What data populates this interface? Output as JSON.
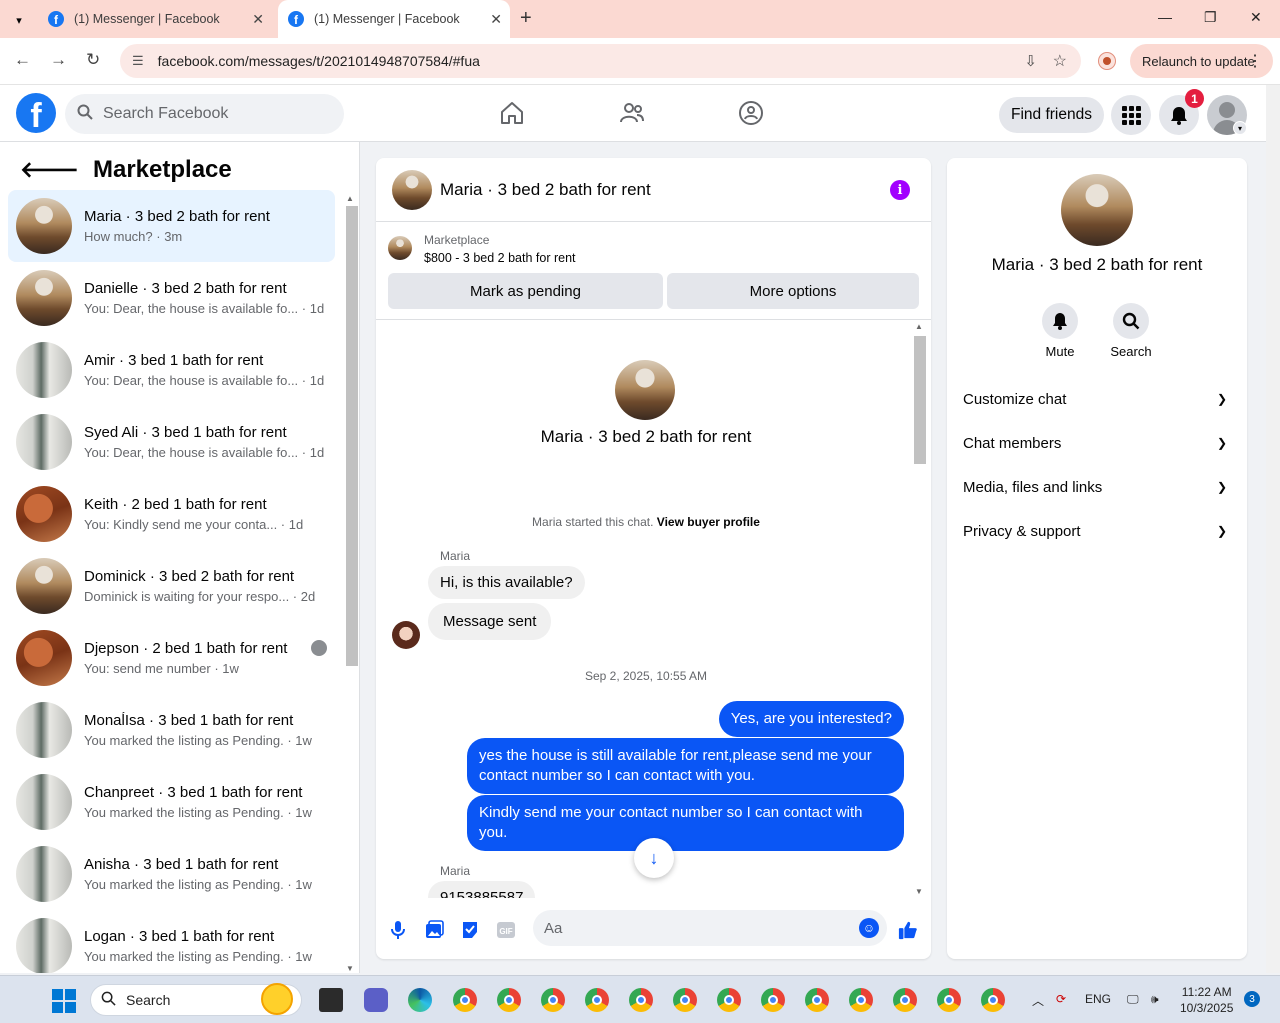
{
  "browser": {
    "tabs": [
      {
        "title": "(1) Messenger | Facebook"
      },
      {
        "title": "(1) Messenger | Facebook"
      }
    ],
    "url": "facebook.com/messages/t/2021014948707584/#fua",
    "relaunch_label": "Relaunch to update"
  },
  "fb_header": {
    "search_placeholder": "Search Facebook",
    "find_friends": "Find friends",
    "notif_count": "1"
  },
  "sidebar": {
    "title": "Marketplace",
    "conversations": [
      {
        "name": "Maria · 3 bed 2 bath for rent",
        "preview": "How much? · 3m",
        "thumb": "kitchen"
      },
      {
        "name": "Danielle · 3 bed 2 bath for rent",
        "preview": "You: Dear, the house is available fo... · 1d",
        "thumb": "kitchen"
      },
      {
        "name": "Amir · 3 bed 1 bath for rent",
        "preview": "You: Dear, the house is available fo... · 1d",
        "thumb": "hall"
      },
      {
        "name": "Syed Ali · 3 bed 1 bath for rent",
        "preview": "You: Dear, the house is available fo... · 1d",
        "thumb": "hall"
      },
      {
        "name": "Keith · 2 bed 1 bath for rent",
        "preview": "You: Kindly send me your conta... · 1d",
        "thumb": "wood"
      },
      {
        "name": "Dominick · 3 bed 2 bath for rent",
        "preview": "Dominick is waiting for your respo... · 2d",
        "thumb": "kitchen"
      },
      {
        "name": "Djepson · 2 bed 1 bath for rent",
        "preview": "You: send me number · 1w",
        "thumb": "wood"
      },
      {
        "name": "MonaĺIsa · 3 bed 1 bath for rent",
        "preview": "You marked the listing as Pending. · 1w",
        "thumb": "hall"
      },
      {
        "name": "Chanpreet · 3 bed 1 bath for rent",
        "preview": "You marked the listing as Pending. · 1w",
        "thumb": "hall"
      },
      {
        "name": "Anisha · 3 bed 1 bath for rent",
        "preview": "You marked the listing as Pending. · 1w",
        "thumb": "hall"
      },
      {
        "name": "Logan · 3 bed 1 bath for rent",
        "preview": "You marked the listing as Pending. · 1w",
        "thumb": "hall"
      }
    ]
  },
  "chat": {
    "title": "Maria · 3 bed 2 bath for rent",
    "marketplace_label": "Marketplace",
    "listing": "$800 - 3 bed 2 bath for rent",
    "mark_pending": "Mark as pending",
    "more_options": "More options",
    "big_name": "Maria · 3 bed 2 bath for rent",
    "started_text": "Maria started this chat.",
    "view_profile": "View buyer profile",
    "sender1": "Maria",
    "msg_in1": "Hi, is this available?",
    "msg_in2": "Message sent",
    "timestamp": "Sep 2, 2025, 10:55 AM",
    "msg_out1": "Yes, are you interested?",
    "msg_out2": "yes the house is still available for rent,please send me your contact number so I can contact with you.",
    "msg_out3": "Kindly send me your contact number so I can contact with you.",
    "sender2": "Maria",
    "msg_in3": "9153885587",
    "composer_placeholder": "Aa"
  },
  "info_panel": {
    "name": "Maria · 3 bed 2 bath for rent",
    "mute": "Mute",
    "search": "Search",
    "rows": [
      "Customize chat",
      "Chat members",
      "Media, files and links",
      "Privacy & support"
    ]
  },
  "taskbar": {
    "search": "Search",
    "lang": "ENG",
    "time": "11:22 AM",
    "date": "10/3/2025",
    "notif": "3"
  }
}
